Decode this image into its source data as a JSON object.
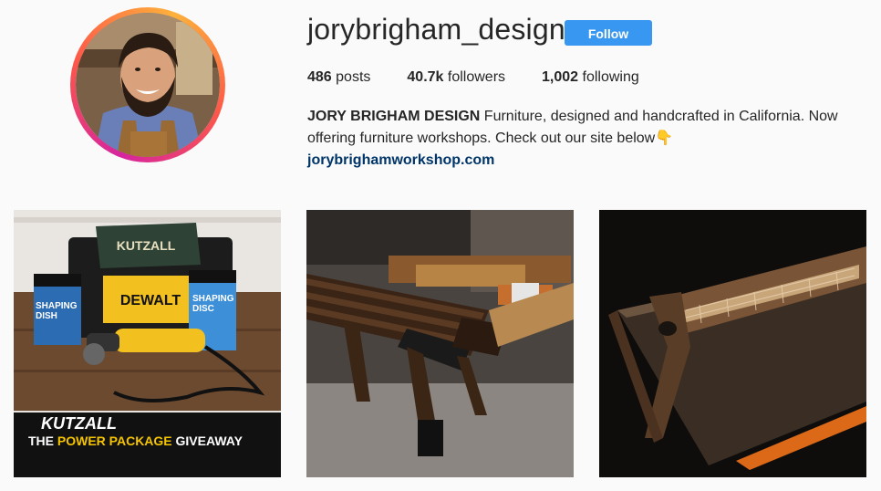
{
  "profile": {
    "username": "jorybrigham_design",
    "follow_label": "Follow",
    "stats": {
      "posts_count": "486",
      "posts_label": " posts",
      "followers_count": "40.7k",
      "followers_label": " followers",
      "following_count": "1,002",
      "following_label": " following"
    },
    "bio": {
      "name": "JORY BRIGHAM DESIGN",
      "text": " Furniture, designed and handcrafted in California. Now offering furniture workshops. Check out our site below",
      "emoji": "👇",
      "link": "jorybrighamworkshop.com"
    }
  },
  "posts": [
    {
      "brand": "KUTZALL",
      "caption_prefix": "THE ",
      "caption_highlight": "POWER PACKAGE",
      "caption_suffix": " GIVEAWAY",
      "product_brand": "DEWALT",
      "product_left": "SHAPING DISH",
      "product_right": "SHAPING DISC"
    },
    {},
    {}
  ],
  "colors": {
    "follow_button": "#3897f0",
    "link": "#003569",
    "highlight_yellow": "#f5c400"
  }
}
